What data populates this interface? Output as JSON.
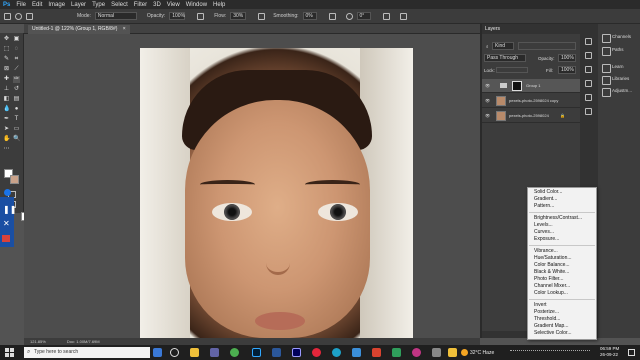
{
  "menubar": {
    "logo": "Ps",
    "items": [
      "File",
      "Edit",
      "Image",
      "Layer",
      "Type",
      "Select",
      "Filter",
      "3D",
      "View",
      "Window",
      "Help"
    ]
  },
  "options": {
    "mode_label": "Mode:",
    "mode_value": "Normal",
    "opacity_label": "Opacity:",
    "opacity_value": "100%",
    "flow_label": "Flow:",
    "flow_value": "30%",
    "smoothing_label": "Smoothing:",
    "smoothing_value": "0%",
    "angle_value": "0°"
  },
  "document": {
    "tab_title": "Untitled-1 @ 122% (Group 1, RGB/8#)",
    "close_glyph": "×"
  },
  "status": {
    "zoom": "121.85%",
    "doc": "Doc: 1.00M/7.69M"
  },
  "layers_panel": {
    "title": "Layers",
    "kind_label": "Kind",
    "blend_value": "Pass Through",
    "opacity_label": "Opacity:",
    "opacity_value": "100%",
    "lock_label": "Lock:",
    "fill_label": "Fill:",
    "fill_value": "100%",
    "layers": [
      {
        "name": "Group 1"
      },
      {
        "name": "pexels-photo-2598024 copy"
      },
      {
        "name": "pexels-photo-2598024"
      }
    ]
  },
  "right_panel": {
    "items": [
      "Channels",
      "Paths",
      "Learn",
      "Libraries",
      "Adjustm..."
    ]
  },
  "adjustment_menu": {
    "groups": [
      [
        "Solid Color...",
        "Gradient...",
        "Pattern..."
      ],
      [
        "Brightness/Contrast...",
        "Levels...",
        "Curves...",
        "Exposure..."
      ],
      [
        "Vibrance...",
        "Hue/Saturation...",
        "Color Balance...",
        "Black & White...",
        "Photo Filter...",
        "Channel Mixer...",
        "Color Lookup..."
      ],
      [
        "Invert",
        "Posterize...",
        "Threshold...",
        "Gradient Map...",
        "Selective Color..."
      ]
    ]
  },
  "recording": {
    "tooltip": "Pause Recording"
  },
  "taskbar": {
    "search_placeholder": "Type here to search",
    "weather": "32°C Haze",
    "time": "06:59 PM",
    "date": "26-09-22"
  },
  "colors": {
    "accent": "#1a73e8",
    "recording_blue": "#1a4fa3",
    "fg_swatch": "#ffffff",
    "bg_swatch": "#c9a28a"
  }
}
